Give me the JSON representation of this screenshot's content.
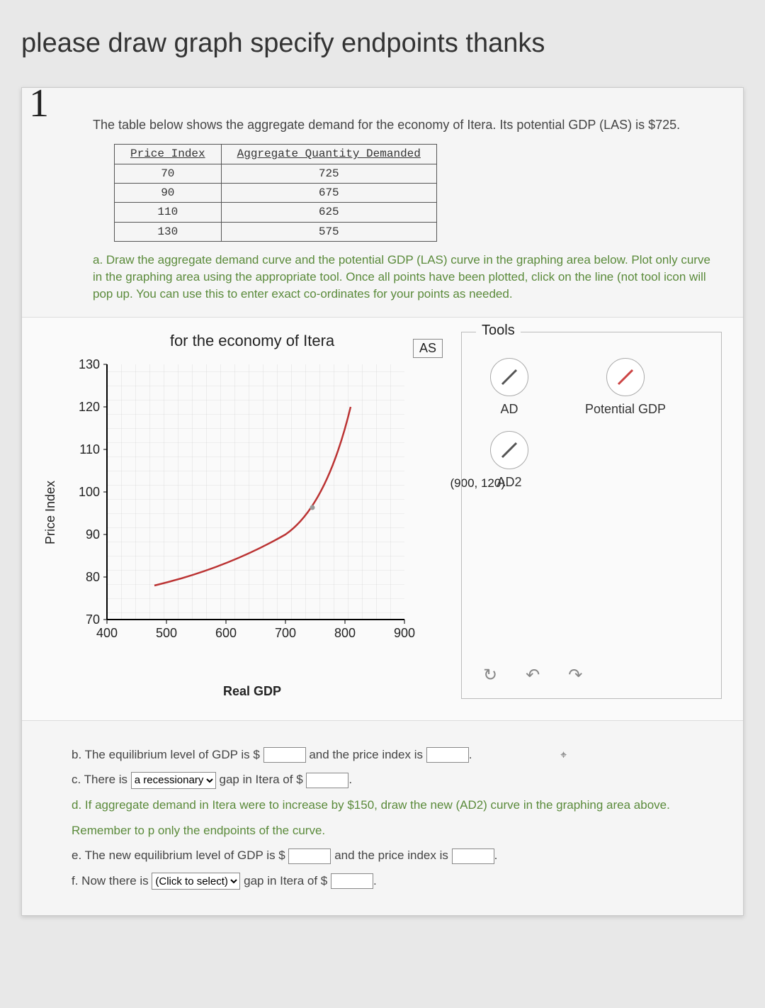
{
  "request_heading": "please draw graph specify endpoints thanks",
  "question_number": "1",
  "intro": "The table below shows the aggregate demand for the economy of Itera. Its potential GDP (LAS) is $725.",
  "table": {
    "headers": [
      "Price Index",
      "Aggregate Quantity Demanded"
    ],
    "rows": [
      [
        "70",
        "725"
      ],
      [
        "90",
        "675"
      ],
      [
        "110",
        "625"
      ],
      [
        "130",
        "575"
      ]
    ]
  },
  "part_a": "a. Draw the aggregate demand curve and the potential GDP (LAS) curve in the graphing area below. Plot only curve in the graphing area using the appropriate tool. Once all points have been plotted, click on the line (not tool icon will pop up. You can use this to enter exact co-ordinates for your points as needed.",
  "graph": {
    "title": "for the economy of Itera",
    "ylabel": "Price Index",
    "xlabel": "Real GDP",
    "as_label": "AS",
    "coord_label": "(900, 120)"
  },
  "tools": {
    "title": "Tools",
    "ad": "AD",
    "potential": "Potential GDP",
    "ad2": "AD2"
  },
  "answers": {
    "b_pre": "b. The equilibrium level of GDP is $",
    "b_mid": " and the price index is ",
    "c_pre": "c. There is ",
    "c_opt1": "a recessionary",
    "c_mid": " gap in Itera of $",
    "d": "d. If aggregate demand in Itera were to increase by $150, draw the new (AD2) curve in the graphing area above. Remember to p only the endpoints of the curve.",
    "e_pre": "e. The new equilibrium level of GDP is $",
    "e_mid": " and the price index is ",
    "f_pre": "f. Now there is ",
    "f_opt1": "(Click to select)",
    "f_mid": " gap in Itera of $"
  },
  "chart_data": {
    "type": "line",
    "title": "for the economy of Itera",
    "xlabel": "Real GDP",
    "ylabel": "Price Index",
    "xlim": [
      400,
      900
    ],
    "ylim": [
      70,
      130
    ],
    "xticks": [
      400,
      500,
      600,
      700,
      800,
      900
    ],
    "yticks": [
      70,
      80,
      90,
      100,
      110,
      120,
      130
    ],
    "series": [
      {
        "name": "drawn-curve",
        "points": [
          {
            "x": 480,
            "y": 78
          },
          {
            "x": 600,
            "y": 82
          },
          {
            "x": 700,
            "y": 90
          },
          {
            "x": 770,
            "y": 102
          },
          {
            "x": 810,
            "y": 120
          }
        ]
      }
    ],
    "annotations": [
      {
        "text": "AS",
        "pos": "top-right-outside"
      },
      {
        "text": "(900, 120)",
        "x": 900,
        "y": 120
      }
    ]
  }
}
